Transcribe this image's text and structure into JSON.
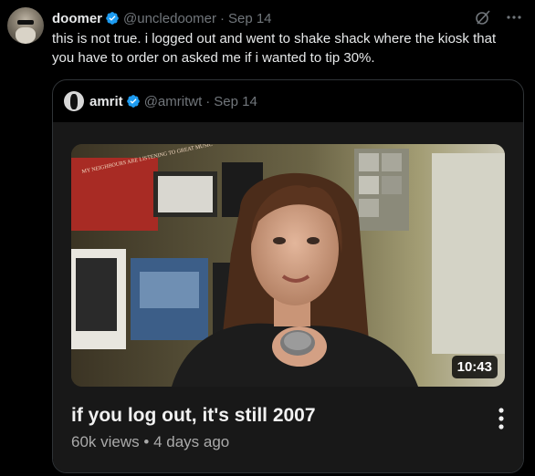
{
  "tweet": {
    "author_name": "doomer",
    "author_handle": "@uncledoomer",
    "separator": "·",
    "date": "Sep 14",
    "text": "this is not true. i logged out and went to shake shack where the kiosk that you have to order on asked me if i wanted to tip 30%."
  },
  "quoted_tweet": {
    "author_name": "amrit",
    "author_handle": "@amritwt",
    "separator": "·",
    "date": "Sep 14"
  },
  "video_card": {
    "duration": "10:43",
    "title": "if you log out, it's still 2007",
    "views": "60k views",
    "separator": "•",
    "age": "4 days ago",
    "poster_text": "MY NEIGHBOURS ARE LISTENING TO GREAT MUSIC"
  },
  "icons": {
    "verified": "verified-badge-icon",
    "grok": "grok-icon",
    "more": "more-horizontal-icon",
    "video_more": "more-vertical-icon"
  },
  "colors": {
    "background": "#000000",
    "text": "#e7e9ea",
    "muted": "#71767b",
    "verified": "#1d9bf0",
    "border": "#2f3336",
    "card": "#181818"
  }
}
